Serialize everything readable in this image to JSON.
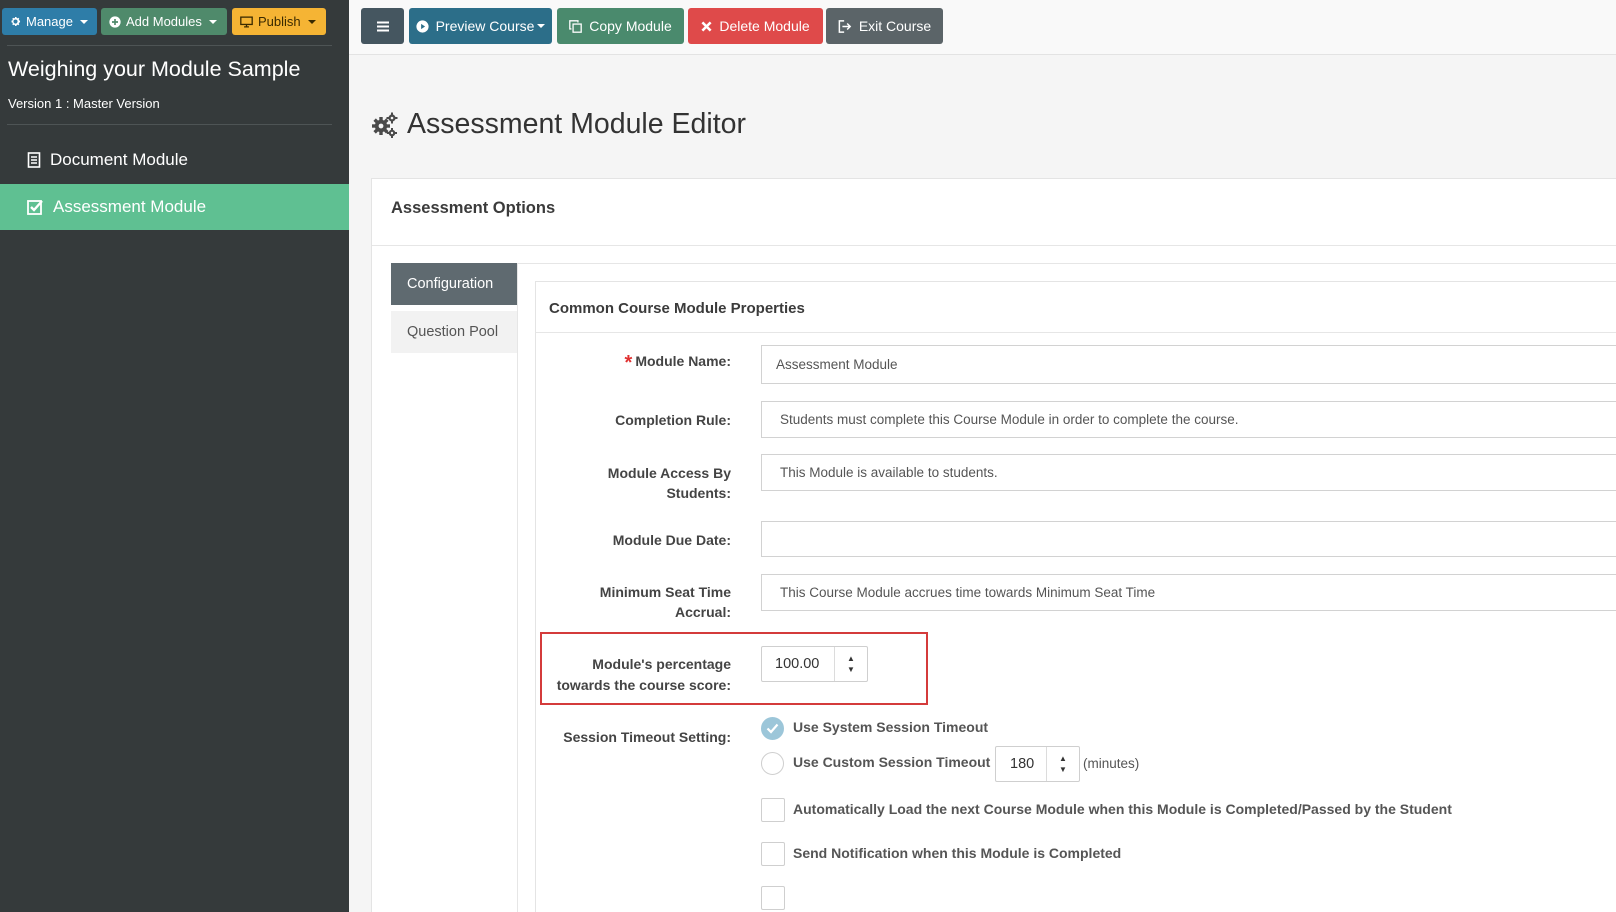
{
  "sidebar": {
    "buttons": {
      "manage": "Manage",
      "add_modules": "Add Modules",
      "publish": "Publish"
    },
    "course_title": "Weighing your Module Sample",
    "version": "Version 1 : Master Version",
    "items": [
      {
        "label": "Document Module",
        "icon": "document-icon",
        "active": false
      },
      {
        "label": "Assessment Module",
        "icon": "checked-box-icon",
        "active": true
      }
    ]
  },
  "toolbar": {
    "preview_label": "Preview Course",
    "copy_label": "Copy Module",
    "delete_label": "Delete Module",
    "exit_label": "Exit Course"
  },
  "page": {
    "title": "Assessment Module Editor",
    "panel_heading": "Assessment Options",
    "tabs": [
      "Configuration",
      "Question Pool"
    ],
    "active_tab": "Configuration"
  },
  "properties": {
    "heading": "Common Course Module Properties",
    "module_name": {
      "label": "Module Name:",
      "value": "Assessment Module",
      "required": true
    },
    "completion_rule": {
      "label": "Completion Rule:",
      "value": "Students must complete this Course Module in order to complete the course."
    },
    "module_access": {
      "label_line1": "Module Access By",
      "label_line2": "Students:",
      "value": "This Module is available to students."
    },
    "due_date": {
      "label": "Module Due Date:",
      "value": ""
    },
    "seat_time": {
      "label_line1": "Minimum Seat Time",
      "label_line2": "Accrual:",
      "value": "This Course Module accrues time towards Minimum Seat Time"
    },
    "percentage": {
      "label_line1": "Module's percentage",
      "label_line2": "towards the course score:",
      "value": "100.00"
    },
    "session_timeout": {
      "label": "Session Timeout Setting:",
      "option_system": "Use System Session Timeout",
      "option_custom": "Use Custom Session Timeout",
      "selected": "system",
      "custom_value": "180",
      "unit": "(minutes)"
    },
    "auto_load": {
      "label": "Automatically Load the next Course Module when this Module is Completed/Passed by the Student",
      "checked": false
    },
    "send_notification": {
      "label": "Send Notification when this Module is Completed",
      "checked": false
    }
  },
  "colors": {
    "sidebar_bg": "#353a3b",
    "active_nav": "#5fc092",
    "delete": "#df4a4a",
    "highlight": "#d43b3b"
  }
}
